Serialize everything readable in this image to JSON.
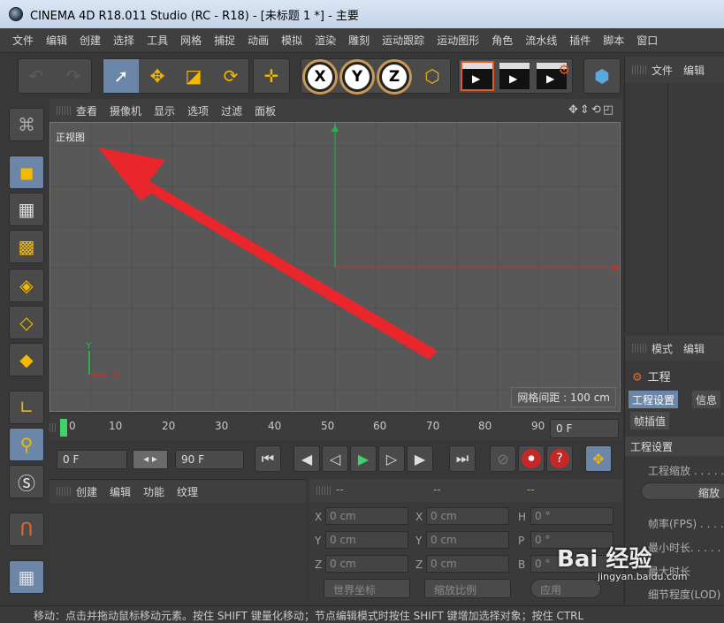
{
  "window": {
    "title": "CINEMA 4D R18.011 Studio (RC - R18) - [未标题 1 *] - 主要"
  },
  "menu": [
    "文件",
    "编辑",
    "创建",
    "选择",
    "工具",
    "网格",
    "捕捉",
    "动画",
    "模拟",
    "渲染",
    "雕刻",
    "运动跟踪",
    "运动图形",
    "角色",
    "流水线",
    "插件",
    "脚本",
    "窗口"
  ],
  "viewport": {
    "menu": [
      "查看",
      "摄像机",
      "显示",
      "选项",
      "过滤",
      "面板"
    ],
    "name": "正视图",
    "grid_info": "网格间距 : 100 cm",
    "axis_y": "Y",
    "axis_x": "X",
    "annotation_color": "#e8262b"
  },
  "timeline": {
    "ticks": [
      "0",
      "10",
      "20",
      "30",
      "40",
      "50",
      "60",
      "70",
      "80",
      "90"
    ],
    "end_frame": "0 F",
    "current_frame": "0 F",
    "max_frame": "90 F"
  },
  "material_panel": {
    "menu": [
      "创建",
      "编辑",
      "功能",
      "纹理"
    ]
  },
  "coords": {
    "headers": [
      "--",
      "--",
      "--"
    ],
    "rows": [
      {
        "a": "X",
        "a_val": "0 cm",
        "b": "X",
        "b_val": "0 cm",
        "c": "H",
        "c_val": "0 °"
      },
      {
        "a": "Y",
        "a_val": "0 cm",
        "b": "Y",
        "b_val": "0 cm",
        "c": "P",
        "c_val": "0 °"
      },
      {
        "a": "Z",
        "a_val": "0 cm",
        "b": "Z",
        "b_val": "0 cm",
        "c": "B",
        "c_val": "0 °"
      }
    ],
    "world_coords": "世界坐标",
    "scale": "缩放比例",
    "apply": "应用"
  },
  "object_manager": {
    "menu": [
      "文件",
      "编辑"
    ]
  },
  "attributes": {
    "menu": [
      "模式",
      "编辑"
    ],
    "title": "工程",
    "tabs": [
      "工程设置",
      "信息",
      "帧插值"
    ],
    "section": "工程设置",
    "project_scale": "工程缩放 . . . . .",
    "scale_button": "缩放",
    "fps": "帧率(FPS) . . . .",
    "min_time": "最小时长. . . . .",
    "max_time": "最大时长",
    "lod": "细节程度(LOD)"
  },
  "status": "移动：点击并拖动鼠标移动元素。按住 SHIFT 键量化移动；节点编辑模式时按住 SHIFT 键增加选择对象；按住 CTRL",
  "watermark": {
    "main": "Bai 经验",
    "sub": "jingyan.baidu.com"
  }
}
